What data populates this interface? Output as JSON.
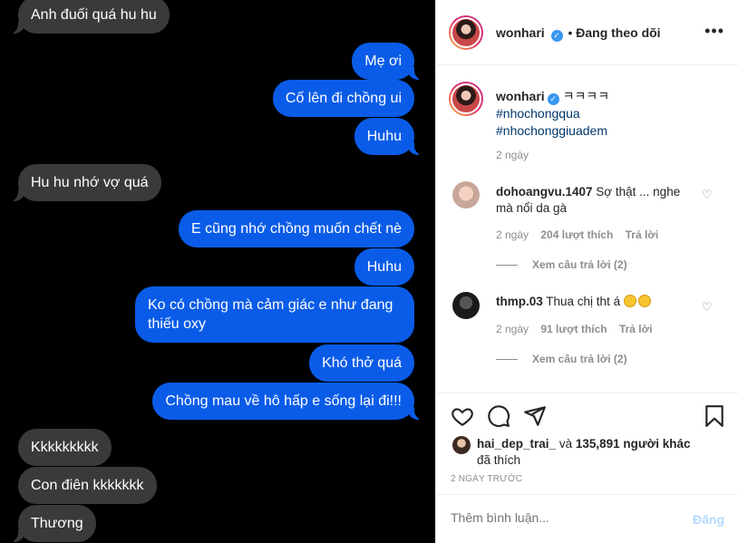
{
  "chat": {
    "messages": [
      {
        "side": "recv",
        "text": "Anh đuối quá hu hu"
      },
      {
        "side": "sent",
        "text": "Mẹ ơi"
      },
      {
        "side": "sent",
        "text": "Cố lên đi chồng ui"
      },
      {
        "side": "sent",
        "text": "Huhu"
      },
      {
        "side": "recv",
        "text": "Hu hu nhớ vợ quá"
      },
      {
        "side": "sent",
        "text": "E cũng nhớ chồng muốn chết nè"
      },
      {
        "side": "sent",
        "text": "Huhu"
      },
      {
        "side": "sent",
        "text": "Ko có chồng mà cảm giác e như đang thiếu oxy"
      },
      {
        "side": "sent",
        "text": "Khó thở quá"
      },
      {
        "side": "sent",
        "text": "Chồng mau về hô hấp e sống lại đi!!!"
      },
      {
        "side": "recv",
        "text": "Kkkkkkkkk"
      },
      {
        "side": "recv",
        "text": "Con điên kkkkkkk"
      },
      {
        "side": "recv",
        "text": "Thương"
      }
    ]
  },
  "post": {
    "header": {
      "username": "wonhari",
      "separator": "•",
      "follow_label": "Đang theo dõi",
      "more_icon": "more-horizontal-icon"
    },
    "caption": {
      "username": "wonhari",
      "text": "ㅋㅋㅋㅋ",
      "hashtags": [
        "#nhochongqua",
        "#nhochonggiuadem"
      ],
      "time": "2 ngày"
    },
    "comments": [
      {
        "username": "dohoangvu.1407",
        "text": "Sợ thật ... nghe mà nổi da gà",
        "time": "2 ngày",
        "likes": "204 lượt thích",
        "reply": "Trả lời",
        "view_replies": "Xem câu trả lời (2)"
      },
      {
        "username": "thmp.03",
        "text": "Thua chị tht á",
        "time": "2 ngày",
        "likes": "91 lượt thích",
        "reply": "Trả lời",
        "view_replies": "Xem câu trả lời (2)"
      }
    ],
    "likes": {
      "user": "hai_dep_trai_",
      "and": "và",
      "count": "135,891 người khác",
      "suffix": "đã thích"
    },
    "date": "2 NGÀY TRƯỚC",
    "comment_box": {
      "placeholder": "Thêm bình luận...",
      "post_label": "Đăng"
    },
    "colors": {
      "sent_bubble": "#0a5ce8",
      "recv_bubble": "#3a3a3c",
      "verified": "#3897f0"
    }
  }
}
